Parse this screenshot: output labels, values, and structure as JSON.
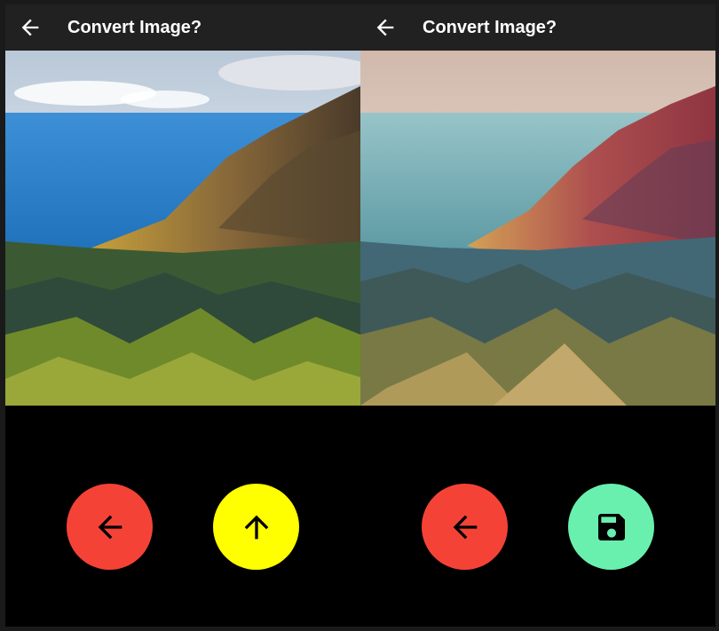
{
  "left_screen": {
    "appbar": {
      "title": "Convert Image?",
      "back_icon": "arrow-back-icon"
    },
    "image": {
      "description_icon": "landscape-original"
    },
    "buttons": {
      "back": {
        "icon": "arrow-back-icon",
        "color": "#f44336"
      },
      "upload": {
        "icon": "arrow-upward-icon",
        "color": "#ffff00"
      }
    }
  },
  "right_screen": {
    "appbar": {
      "title": "Convert Image?",
      "back_icon": "arrow-back-icon"
    },
    "image": {
      "description_icon": "landscape-stylized"
    },
    "buttons": {
      "back": {
        "icon": "arrow-back-icon",
        "color": "#f44336"
      },
      "save": {
        "icon": "save-icon",
        "color": "#69f0ae"
      }
    }
  }
}
